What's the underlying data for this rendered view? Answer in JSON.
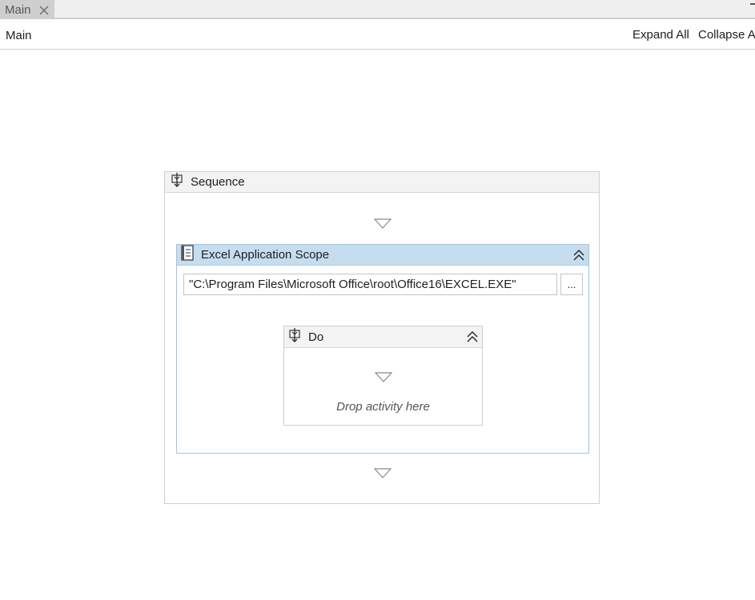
{
  "tabs": [
    {
      "label": "Main"
    }
  ],
  "breadcrumb": "Main",
  "toolbar": {
    "expand_all_label": "Expand All",
    "collapse_all_label": "Collapse All"
  },
  "sequence": {
    "title": "Sequence",
    "icon": "sequence-icon"
  },
  "excel_scope": {
    "title": "Excel Application Scope",
    "icon": "excel-workbook-icon",
    "path_value": "\"C:\\Program Files\\Microsoft Office\\root\\Office16\\EXCEL.EXE\"",
    "browse_label": "..."
  },
  "do_block": {
    "title": "Do",
    "icon": "sequence-icon",
    "drop_hint": "Drop activity here"
  },
  "colors": {
    "scope_header": "#c6ddef",
    "scope_border": "#9fc3df",
    "header_gray": "#f3f3f3"
  }
}
